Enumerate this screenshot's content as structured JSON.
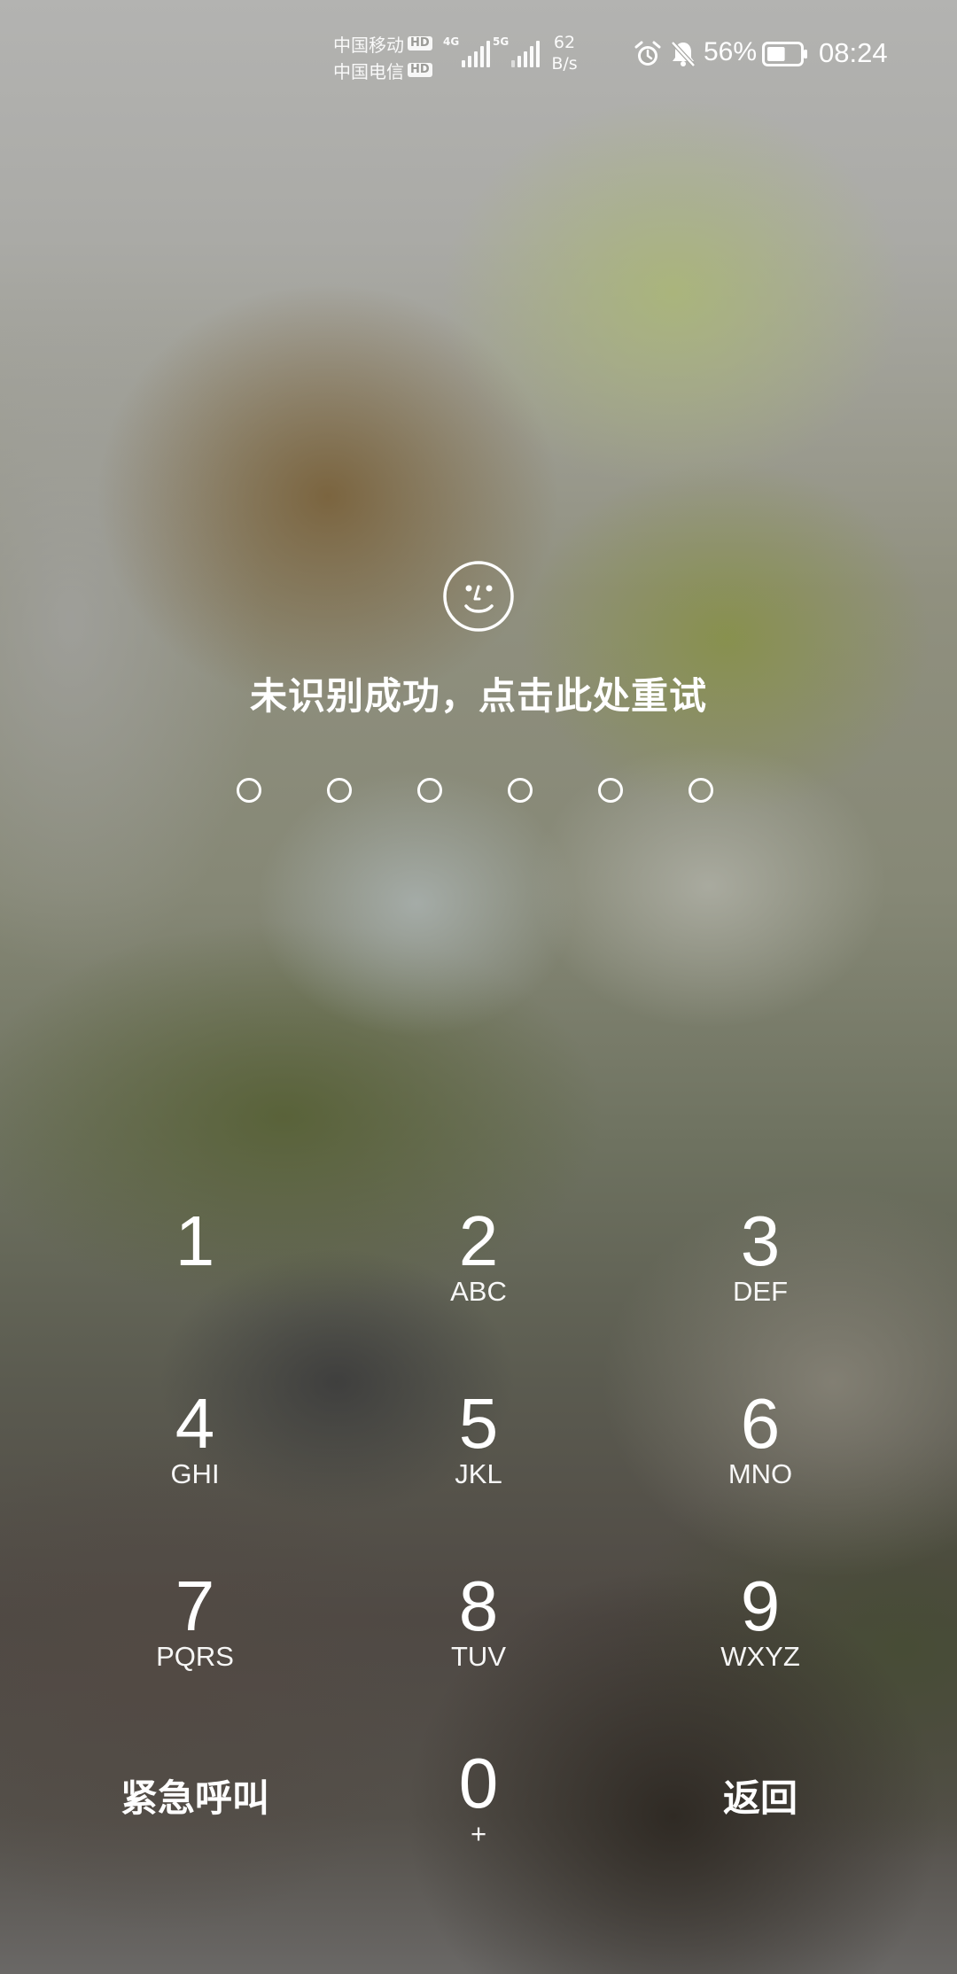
{
  "status_bar": {
    "carrier_1": "中国移动",
    "carrier_2": "中国电信",
    "hd_label": "HD",
    "net_type_1": "4G",
    "net_type_2": "5G",
    "net_speed_value": "62",
    "net_speed_unit": "B/s",
    "battery_percent": "56%",
    "battery_level": 0.56,
    "time": "08:24",
    "icons": [
      "alarm-icon",
      "mute-bell-icon",
      "battery-icon"
    ]
  },
  "lock": {
    "face_icon": "face-unlock-icon",
    "prompt": "未识别成功，点击此处重试",
    "pin_length": 6,
    "pin_entered": 0
  },
  "keypad": {
    "keys": [
      {
        "digit": "1",
        "letters": ""
      },
      {
        "digit": "2",
        "letters": "ABC"
      },
      {
        "digit": "3",
        "letters": "DEF"
      },
      {
        "digit": "4",
        "letters": "GHI"
      },
      {
        "digit": "5",
        "letters": "JKL"
      },
      {
        "digit": "6",
        "letters": "MNO"
      },
      {
        "digit": "7",
        "letters": "PQRS"
      },
      {
        "digit": "8",
        "letters": "TUV"
      },
      {
        "digit": "9",
        "letters": "WXYZ"
      },
      {
        "digit": "0",
        "letters": "+"
      }
    ],
    "emergency_label": "紧急呼叫",
    "back_label": "返回"
  },
  "colors": {
    "text": "#ffffff"
  }
}
